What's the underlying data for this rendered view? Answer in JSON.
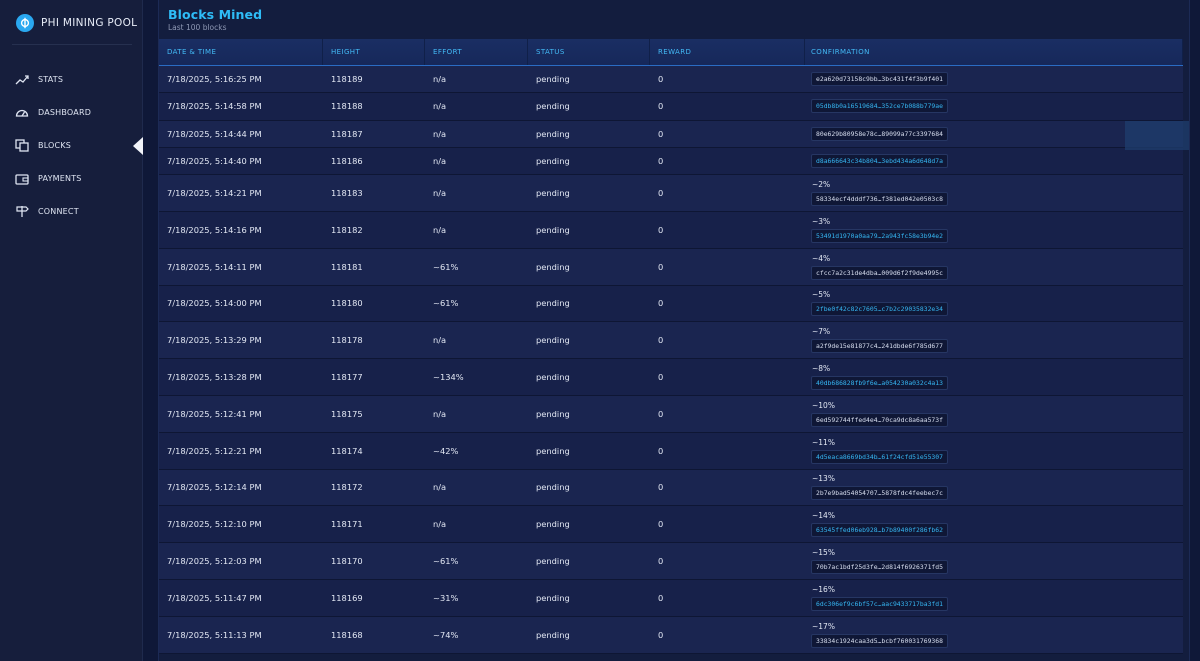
{
  "brand": {
    "name": "PHI MINING POOL",
    "icon": "phi-logo-icon"
  },
  "nav": [
    {
      "label": "STATS",
      "icon": "trend-line-icon"
    },
    {
      "label": "DASHBOARD",
      "icon": "gauge-icon"
    },
    {
      "label": "BLOCKS",
      "icon": "blocks-icon",
      "active": true
    },
    {
      "label": "PAYMENTS",
      "icon": "wallet-icon"
    },
    {
      "label": "CONNECT",
      "icon": "signpost-icon"
    }
  ],
  "page": {
    "title": "Blocks Mined",
    "subtitle": "Last 100 blocks"
  },
  "columns": [
    "DATE & TIME",
    "HEIGHT",
    "EFFORT",
    "STATUS",
    "REWARD",
    "CONFIRMATION"
  ],
  "colors": {
    "accent": "#2ebcf7",
    "link": "#36b7f3",
    "background": "#0d1530"
  },
  "rows": [
    {
      "date": "7/18/2025, 5:16:25 PM",
      "height": "118189",
      "effort": "n/a",
      "status": "pending",
      "reward": "0",
      "confirmation": "",
      "hash": "e2a620d73158c9bb…3bc431f4f3b9f401",
      "hash_link": false
    },
    {
      "date": "7/18/2025, 5:14:58 PM",
      "height": "118188",
      "effort": "n/a",
      "status": "pending",
      "reward": "0",
      "confirmation": "",
      "hash": "05db8b0a16519684…352ce7b088b779ae",
      "hash_link": true
    },
    {
      "date": "7/18/2025, 5:14:44 PM",
      "height": "118187",
      "effort": "n/a",
      "status": "pending",
      "reward": "0",
      "confirmation": "",
      "hash": "80e629b80958e78c…89099a77c3397684",
      "hash_link": false
    },
    {
      "date": "7/18/2025, 5:14:40 PM",
      "height": "118186",
      "effort": "n/a",
      "status": "pending",
      "reward": "0",
      "confirmation": "",
      "hash": "d8a666643c34b804…3ebd434a6d648d7a",
      "hash_link": true
    },
    {
      "date": "7/18/2025, 5:14:21 PM",
      "height": "118183",
      "effort": "n/a",
      "status": "pending",
      "reward": "0",
      "confirmation": "~2%",
      "hash": "58334ecf4dddf736…f381ed042e0503c8",
      "hash_link": false
    },
    {
      "date": "7/18/2025, 5:14:16 PM",
      "height": "118182",
      "effort": "n/a",
      "status": "pending",
      "reward": "0",
      "confirmation": "~3%",
      "hash": "53491d1970a0aa79…2a943fc58e3b94e2",
      "hash_link": true
    },
    {
      "date": "7/18/2025, 5:14:11 PM",
      "height": "118181",
      "effort": "~61%",
      "status": "pending",
      "reward": "0",
      "confirmation": "~4%",
      "hash": "cfcc7a2c31de4dba…009d6f2f9de4995c",
      "hash_link": false
    },
    {
      "date": "7/18/2025, 5:14:00 PM",
      "height": "118180",
      "effort": "~61%",
      "status": "pending",
      "reward": "0",
      "confirmation": "~5%",
      "hash": "2fbe0f42c82c7605…c7b2c29035832e34",
      "hash_link": true
    },
    {
      "date": "7/18/2025, 5:13:29 PM",
      "height": "118178",
      "effort": "n/a",
      "status": "pending",
      "reward": "0",
      "confirmation": "~7%",
      "hash": "a2f9de15e81877c4…241dbde6f785d677",
      "hash_link": false
    },
    {
      "date": "7/18/2025, 5:13:28 PM",
      "height": "118177",
      "effort": "~134%",
      "status": "pending",
      "reward": "0",
      "confirmation": "~8%",
      "hash": "40db686828fb9f6e…a054230a032c4a13",
      "hash_link": true
    },
    {
      "date": "7/18/2025, 5:12:41 PM",
      "height": "118175",
      "effort": "n/a",
      "status": "pending",
      "reward": "0",
      "confirmation": "~10%",
      "hash": "6ed592744ffed4e4…70ca9dc8a6aa573f",
      "hash_link": false
    },
    {
      "date": "7/18/2025, 5:12:21 PM",
      "height": "118174",
      "effort": "~42%",
      "status": "pending",
      "reward": "0",
      "confirmation": "~11%",
      "hash": "4d5eaca8669bd34b…61f24cfd51e55307",
      "hash_link": true
    },
    {
      "date": "7/18/2025, 5:12:14 PM",
      "height": "118172",
      "effort": "n/a",
      "status": "pending",
      "reward": "0",
      "confirmation": "~13%",
      "hash": "2b7e9bad54054707…5878fdc4feebec7c",
      "hash_link": false
    },
    {
      "date": "7/18/2025, 5:12:10 PM",
      "height": "118171",
      "effort": "n/a",
      "status": "pending",
      "reward": "0",
      "confirmation": "~14%",
      "hash": "63545ffed06eb928…b7b89400f286fb62",
      "hash_link": true
    },
    {
      "date": "7/18/2025, 5:12:03 PM",
      "height": "118170",
      "effort": "~61%",
      "status": "pending",
      "reward": "0",
      "confirmation": "~15%",
      "hash": "70b7ac1bdf25d3fe…2d814f6926371fd5",
      "hash_link": false
    },
    {
      "date": "7/18/2025, 5:11:47 PM",
      "height": "118169",
      "effort": "~31%",
      "status": "pending",
      "reward": "0",
      "confirmation": "~16%",
      "hash": "6dc306ef9c6bf57c…aac9433717ba3fd1",
      "hash_link": true
    },
    {
      "date": "7/18/2025, 5:11:13 PM",
      "height": "118168",
      "effort": "~74%",
      "status": "pending",
      "reward": "0",
      "confirmation": "~17%",
      "hash": "33834c1924caa3d5…bcbf760031769368",
      "hash_link": false
    }
  ]
}
